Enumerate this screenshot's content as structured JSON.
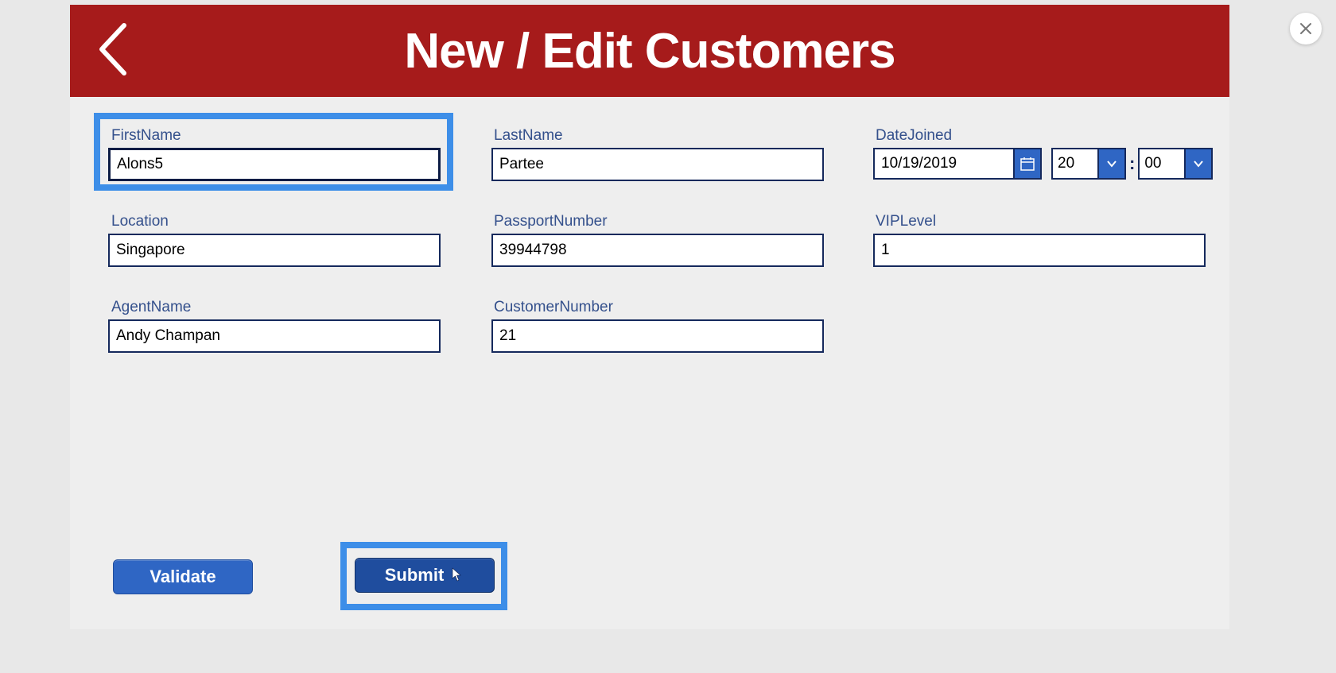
{
  "header": {
    "title": "New / Edit Customers"
  },
  "fields": {
    "firstName": {
      "label": "FirstName",
      "value": "Alons5"
    },
    "lastName": {
      "label": "LastName",
      "value": "Partee"
    },
    "dateJoined": {
      "label": "DateJoined",
      "date": "10/19/2019",
      "hour": "20",
      "minute": "00"
    },
    "location": {
      "label": "Location",
      "value": "Singapore"
    },
    "passportNumber": {
      "label": "PassportNumber",
      "value": "39944798"
    },
    "vipLevel": {
      "label": "VIPLevel",
      "value": "1"
    },
    "agentName": {
      "label": "AgentName",
      "value": "Andy Champan"
    },
    "customerNumber": {
      "label": "CustomerNumber",
      "value": "21"
    }
  },
  "buttons": {
    "validate": "Validate",
    "submit": "Submit"
  },
  "timeSeparator": ":"
}
